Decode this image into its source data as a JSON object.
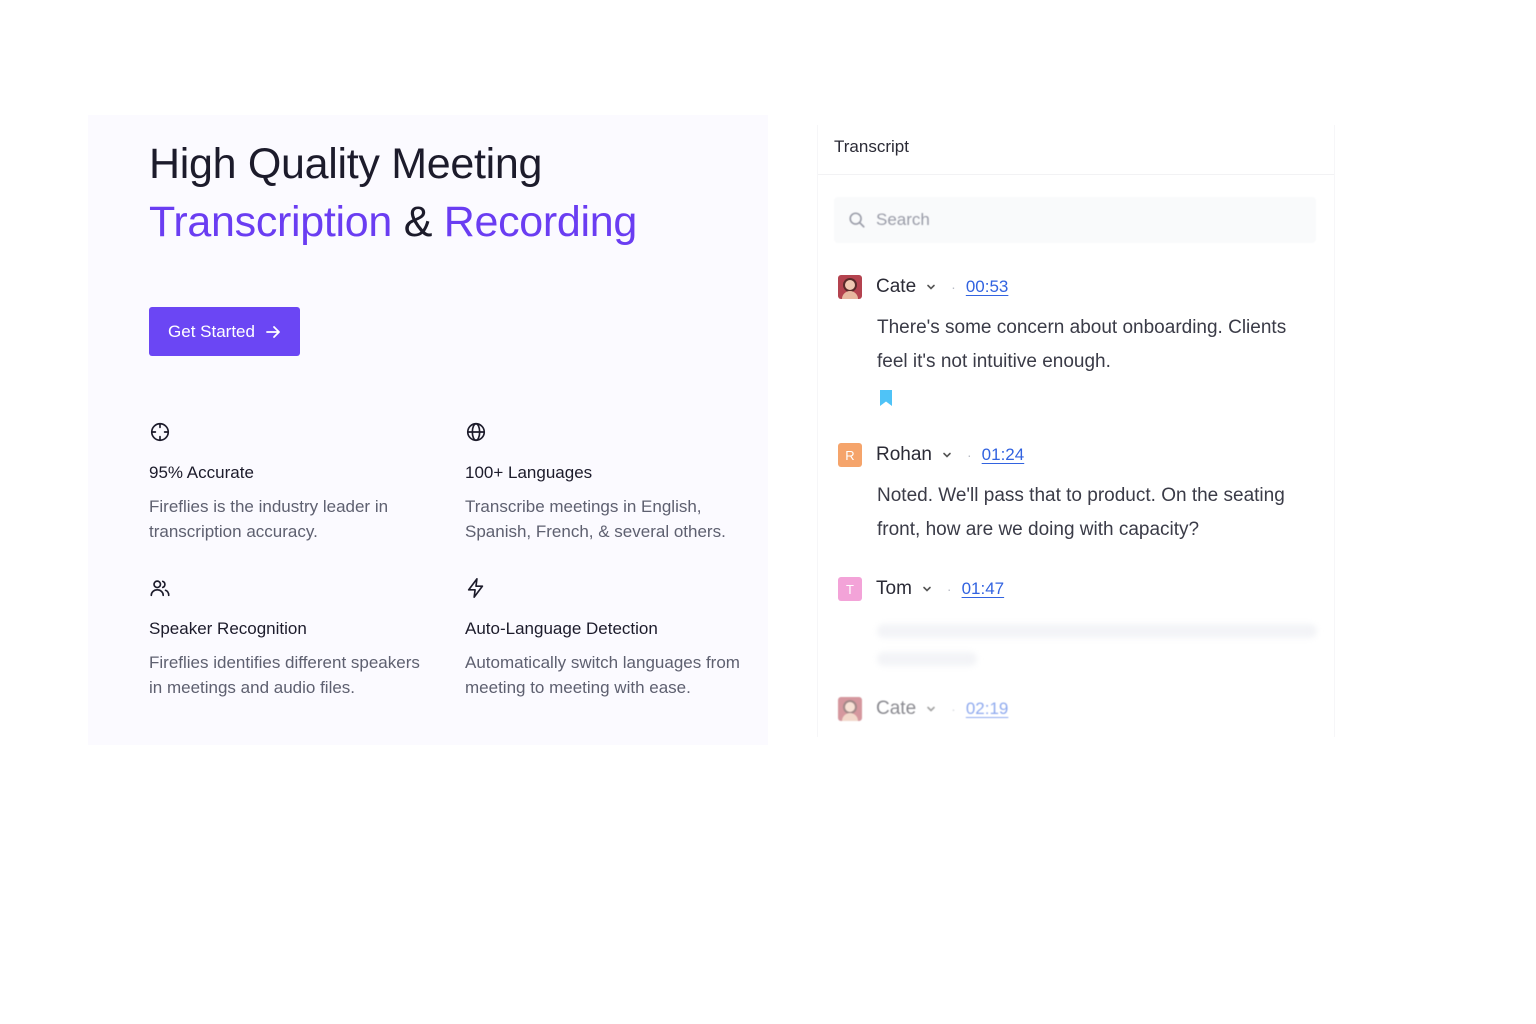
{
  "hero": {
    "title_line1": "High Quality Meeting",
    "title_accent1": "Transcription",
    "title_amp": " & ",
    "title_accent2": "Recording",
    "cta_label": "Get Started"
  },
  "features": [
    {
      "icon": "crosshair-icon",
      "title": "95% Accurate",
      "desc": "Fireflies is the industry leader in transcription accuracy."
    },
    {
      "icon": "globe-icon",
      "title": "100+ Languages",
      "desc": "Transcribe meetings in English, Spanish, French, & several others."
    },
    {
      "icon": "users-icon",
      "title": "Speaker Recognition",
      "desc": "Fireflies identifies different speakers in meetings and audio files."
    },
    {
      "icon": "lightning-icon",
      "title": "Auto-Language Detection",
      "desc": "Automatically switch languages from meeting to meeting with ease."
    }
  ],
  "transcript": {
    "header": "Transcript",
    "search_placeholder": "Search",
    "entries": [
      {
        "speaker": "Cate",
        "avatar": "photo",
        "time": "00:53",
        "text": "There's some concern about onboarding. Clients feel it's not intuitive enough.",
        "bookmarked": true
      },
      {
        "speaker": "Rohan",
        "avatar_letter": "R",
        "avatar_color": "#f5a46b",
        "time": "01:24",
        "text": "Noted. We'll pass that to product. On the seating front, how are we doing with capacity?"
      },
      {
        "speaker": "Tom",
        "avatar_letter": "T",
        "avatar_color": "#f3a3d8",
        "time": "01:47",
        "text": ""
      },
      {
        "speaker": "Cate",
        "avatar": "photo",
        "time": "02:19",
        "text": ""
      }
    ]
  },
  "colors": {
    "accent": "#6a3df2",
    "cta_bg": "#6b46f4",
    "link": "#3263e0",
    "bookmark": "#4fc3f7"
  }
}
